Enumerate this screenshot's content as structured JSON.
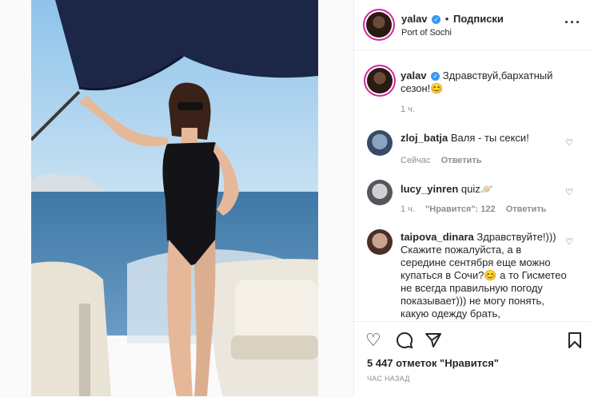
{
  "post": {
    "username": "yalav",
    "follow_label": "Подписки",
    "location": "Port of Sochi",
    "more_icon": "more-horizontal-icon"
  },
  "caption": {
    "username": "yalav",
    "text": "Здравствуй,бархатный сезон!😊",
    "time": "1 ч."
  },
  "comments": [
    {
      "username": "zloj_batja",
      "text": "Валя - ты секси!",
      "time": "Сейчас",
      "reply": "Ответить",
      "likes": ""
    },
    {
      "username": "lucy_yinren",
      "text": "quiz🪐",
      "time": "1 ч.",
      "likes": "\"Нравится\": 122",
      "reply": "Ответить"
    },
    {
      "username": "taipova_dinara",
      "text": "Здравствуйте!))) Скажите пожалуйста, а в середине сентября еще можно купаться в Сочи?😊 а то Гисметео не всегда правильную погоду показывает))) не могу понять, какую одежду брать,"
    }
  ],
  "footer": {
    "likes": "5 447 отметок \"Нравится\"",
    "time": "ЧАС НАЗАД"
  },
  "colors": {
    "accent": "#3897f0",
    "border": "#efefef",
    "muted": "#8e8e8e"
  }
}
